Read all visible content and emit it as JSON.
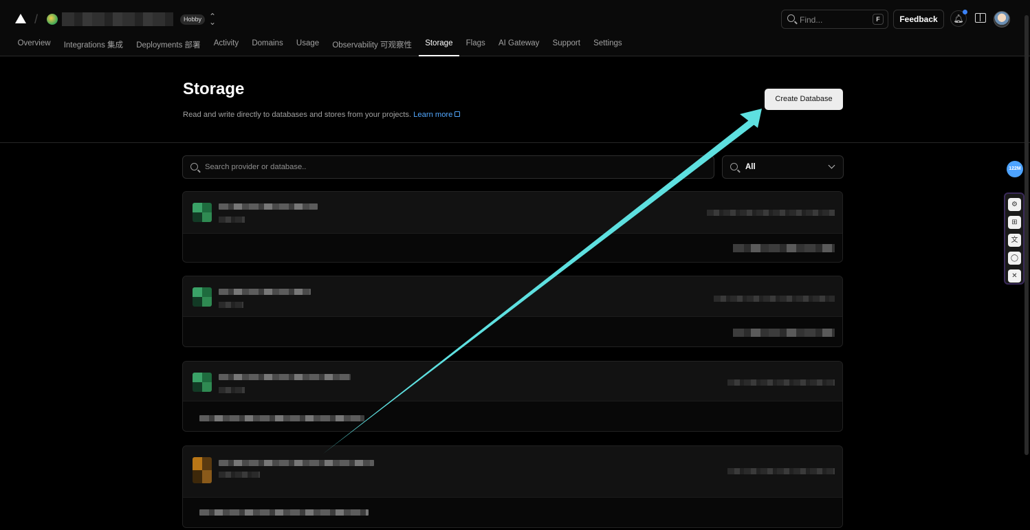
{
  "header": {
    "plan_badge": "Hobby",
    "find_placeholder": "Find...",
    "find_shortcut": "F",
    "feedback_label": "Feedback"
  },
  "nav": {
    "items": [
      {
        "label": "Overview"
      },
      {
        "label": "Integrations 集成"
      },
      {
        "label": "Deployments 部署"
      },
      {
        "label": "Activity"
      },
      {
        "label": "Domains"
      },
      {
        "label": "Usage"
      },
      {
        "label": "Observability 可观察性"
      },
      {
        "label": "Storage",
        "active": true
      },
      {
        "label": "Flags"
      },
      {
        "label": "AI Gateway"
      },
      {
        "label": "Support"
      },
      {
        "label": "Settings"
      }
    ]
  },
  "page": {
    "title": "Storage",
    "description": "Read and write directly to databases and stores from your projects.",
    "learn_more": "Learn more",
    "create_button": "Create Database"
  },
  "search": {
    "placeholder": "Search provider or database..",
    "filter_value": "All"
  },
  "floating": {
    "badge": "122M"
  },
  "icons": {
    "logo": "vercel-triangle-icon",
    "search": "search-icon",
    "notifications": "bell-icon",
    "docs": "book-icon",
    "chevron": "chevron-down-icon",
    "external": "external-link-icon"
  },
  "colors": {
    "accent_link": "#52a8ff",
    "annotation_arrow": "#5ee0e0",
    "notification_dot": "#3b82f6"
  }
}
